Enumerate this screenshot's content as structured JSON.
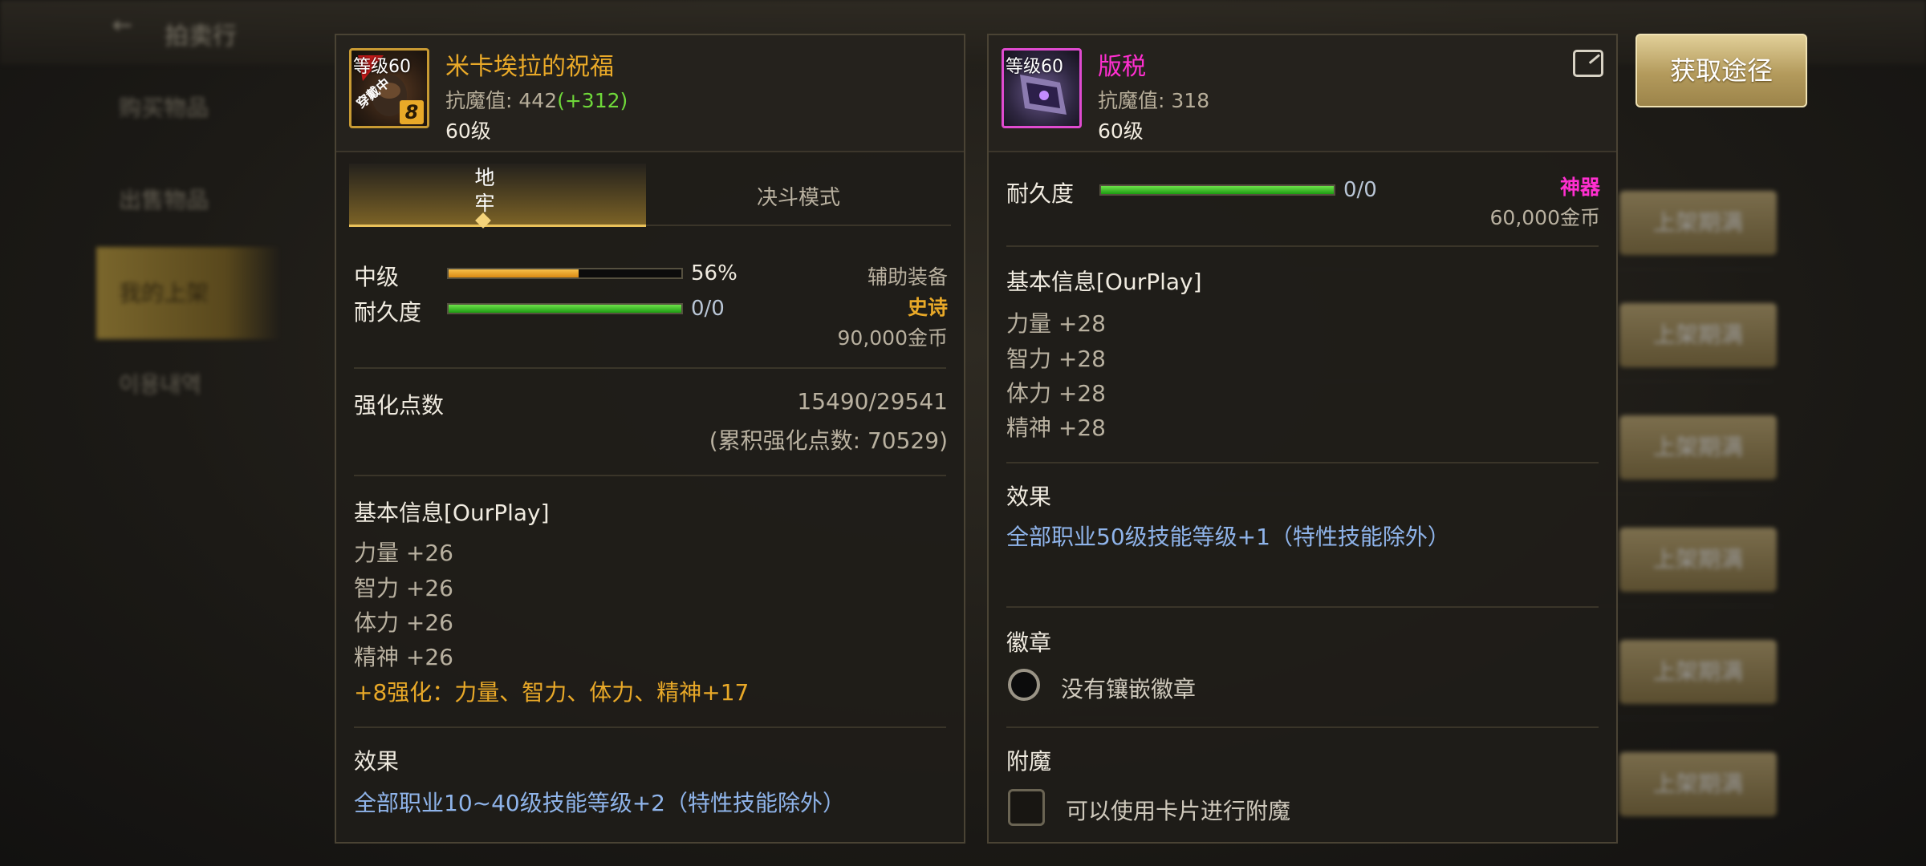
{
  "background": {
    "title": "拍卖行",
    "side_items": [
      "购买物品",
      "出售物品",
      "我的上架",
      "이용내역"
    ],
    "list_button": "上架期满"
  },
  "colors": {
    "gold": "#e9a928",
    "blue": "#8fb4ea",
    "magenta": "#ff2fd0",
    "green": "#31c41c",
    "orange": "#f1a31f"
  },
  "left": {
    "icon": "dark-helmet-icon",
    "level_tag": "等级60",
    "icon_badge": "8",
    "icon_ribbon": "穿戴中",
    "name": "米卡埃拉的祝福",
    "resist_label": "抗魔值:",
    "resist_value": "442",
    "resist_bonus": "(+312)",
    "level": "60级",
    "tabs": [
      "地牢",
      "决斗模式"
    ],
    "grade_label": "中级",
    "grade_percent": "56%",
    "grade_fill": 0.56,
    "durability_label": "耐久度",
    "durability_value": "0/0",
    "durability_fill": 1.0,
    "type": "辅助装备",
    "rarity": "史诗",
    "price": "90,000金币",
    "enhance_label": "强化点数",
    "enhance_value": "15490/29541",
    "enhance_total": "(累积强化点数: 70529)",
    "basic_info_title": "基本信息[OurPlay]",
    "stats": [
      "力量 +26",
      "智力 +26",
      "体力 +26",
      "精神 +26"
    ],
    "enhance_bonus": "+8强化：力量、智力、体力、精神+17",
    "effect_title": "效果",
    "effect_text": "全部职业10~40级技能等级+2（特性技能除外）"
  },
  "right": {
    "icon": "purple-earring-icon",
    "level_tag": "等级60",
    "name": "版税",
    "resist_label": "抗魔值:",
    "resist_value": "318",
    "level": "60级",
    "durability_label": "耐久度",
    "durability_value": "0/0",
    "durability_fill": 1.0,
    "rarity": "神器",
    "price": "60,000金币",
    "basic_info_title": "基本信息[OurPlay]",
    "stats": [
      "力量 +28",
      "智力 +28",
      "体力 +28",
      "精神 +28"
    ],
    "effect_title": "效果",
    "effect_text": "全部职业50级技能等级+1（特性技能除外）",
    "emblem_title": "徽章",
    "emblem_text": "没有镶嵌徽章",
    "enchant_title": "附魔",
    "enchant_text": "可以使用卡片进行附魔"
  },
  "get_path_button": "获取途径"
}
